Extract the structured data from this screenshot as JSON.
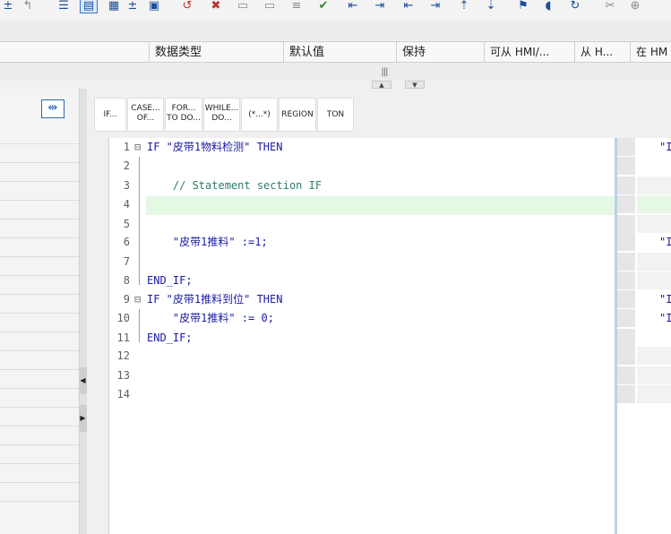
{
  "toolbar": {
    "icons": [
      "toolbar-icon-1",
      "toolbar-icon-2",
      "toolbar-icon-3",
      "toolbar-icon-4",
      "toolbar-icon-5",
      "toolbar-icon-6",
      "toolbar-icon-7",
      "toolbar-icon-8",
      "toolbar-icon-9",
      "toolbar-icon-10",
      "toolbar-icon-11",
      "toolbar-icon-12",
      "toolbar-icon-13",
      "toolbar-icon-14",
      "toolbar-icon-15",
      "toolbar-icon-16",
      "toolbar-icon-17",
      "toolbar-icon-18",
      "toolbar-icon-19",
      "toolbar-icon-20",
      "toolbar-icon-21",
      "toolbar-icon-22",
      "toolbar-icon-23",
      "toolbar-icon-24"
    ]
  },
  "columns": {
    "data_type": "数据类型",
    "default_value": "默认值",
    "retain": "保持",
    "accessible_from_hmi": "可从 HMI/...",
    "from_hmi": "从 H...",
    "in_hmi": "在 HM"
  },
  "splitter": {
    "grip": "|||"
  },
  "instructions": {
    "if": "IF...",
    "case_l1": "CASE...",
    "case_l2": "OF...",
    "for_l1": "FOR...",
    "for_l2": "TO DO...",
    "while_l1": "WHILE...",
    "while_l2": "DO...",
    "comment": "(*...*)",
    "region": "REGION",
    "ton": "TON"
  },
  "editor": {
    "lines": [
      {
        "num": "1",
        "fold": "⊟",
        "code": "IF \"皮带1物料检测\" THEN"
      },
      {
        "num": "2",
        "fold": "",
        "code": ""
      },
      {
        "num": "3",
        "fold": "",
        "code": "    // Statement section IF"
      },
      {
        "num": "4",
        "fold": "",
        "code": ""
      },
      {
        "num": "5",
        "fold": "",
        "code": ""
      },
      {
        "num": "6",
        "fold": "",
        "code": "    \"皮带1推料\" :=1;"
      },
      {
        "num": "7",
        "fold": "",
        "code": ""
      },
      {
        "num": "8",
        "fold": "",
        "code": "END_IF;"
      },
      {
        "num": "9",
        "fold": "⊟",
        "code": "IF \"皮带1推料到位\" THEN"
      },
      {
        "num": "10",
        "fold": "",
        "code": "    \"皮带1推料\" := 0;"
      },
      {
        "num": "11",
        "fold": "",
        "code": "END_IF;"
      },
      {
        "num": "12",
        "fold": "",
        "code": ""
      },
      {
        "num": "13",
        "fold": "",
        "code": ""
      },
      {
        "num": "14",
        "fold": "",
        "code": ""
      }
    ]
  },
  "right_panel": {
    "row1": "\"I",
    "row6": "\"I",
    "row9": "\"I",
    "row10": "\"I"
  },
  "colors": {
    "keyword": "#1a1aa6",
    "comment": "#2e7d6e",
    "current_line": "#e4f8e4",
    "accent": "#2f66b3"
  }
}
